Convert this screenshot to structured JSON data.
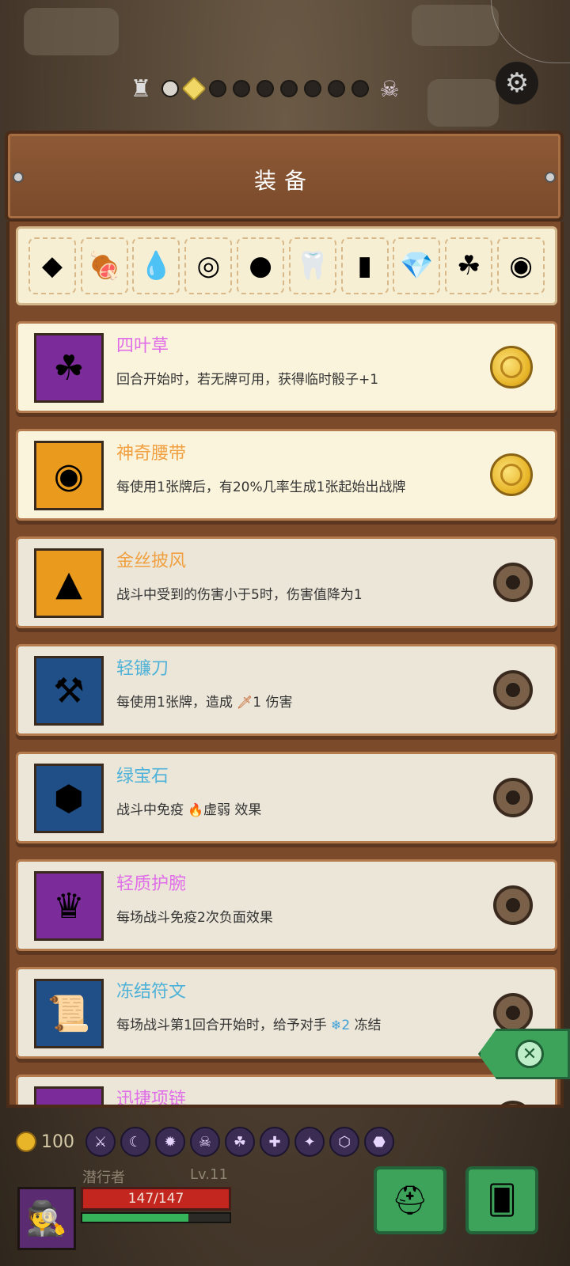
{
  "header": {
    "title": "装备"
  },
  "top_bar": {
    "castle_icon": "castle-icon",
    "boss_icon": "boss-skull-icon",
    "progress": {
      "total_nodes": 9,
      "completed": 1,
      "current_index": 1
    }
  },
  "equip_strip": {
    "slots": [
      {
        "icon": "ruby-ornament-icon",
        "glyph": "◆"
      },
      {
        "icon": "ham-icon",
        "glyph": "🍖"
      },
      {
        "icon": "water-drop-icon",
        "glyph": "💧"
      },
      {
        "icon": "spiked-bracelet-icon",
        "glyph": "◎"
      },
      {
        "icon": "button-icon",
        "glyph": "●"
      },
      {
        "icon": "fangs-icon",
        "glyph": "🦷"
      },
      {
        "icon": "moss-brick-icon",
        "glyph": "▮"
      },
      {
        "icon": "blue-gems-icon",
        "glyph": "💎"
      },
      {
        "icon": "four-leaf-clover-icon",
        "glyph": "☘"
      },
      {
        "icon": "magic-belt-icon",
        "glyph": "◉"
      }
    ]
  },
  "items": [
    {
      "name": "四叶草",
      "desc": "回合开始时，若无牌可用，获得临时骰子+1",
      "rarity": "purple",
      "icon": "four-leaf-clover-icon",
      "glyph": "☘",
      "coin": "gold"
    },
    {
      "name": "神奇腰带",
      "desc": "每使用1张牌后，有20%几率生成1张起始出战牌",
      "rarity": "orange",
      "icon": "magic-belt-icon",
      "glyph": "◉",
      "coin": "gold"
    },
    {
      "name": "金丝披风",
      "desc": "战斗中受到的伤害小于5时，伤害值降为1",
      "rarity": "orange",
      "icon": "golden-cloak-icon",
      "glyph": "▲",
      "coin": "dark"
    },
    {
      "name": "轻镰刀",
      "desc_pre": "每使用1张牌，造成",
      "desc_value": "1",
      "desc_post": "伤害",
      "rarity": "blue",
      "icon": "sickle-icon",
      "glyph": "⚒",
      "coin": "dark"
    },
    {
      "name": "绿宝石",
      "desc_pre": "战斗中免疫",
      "desc_value": "虚弱",
      "desc_post": "效果",
      "rarity": "blue",
      "icon": "emerald-icon",
      "glyph": "⬢",
      "coin": "dark"
    },
    {
      "name": "轻质护腕",
      "desc": "每场战斗免疫2次负面效果",
      "rarity": "purple",
      "icon": "light-bracer-icon",
      "glyph": "♛",
      "coin": "dark"
    },
    {
      "name": "冻结符文",
      "desc_pre": "每场战斗第1回合开始时，给予对手",
      "desc_value": "2",
      "desc_post": "冻结",
      "rarity": "blue",
      "icon": "frost-rune-scroll-icon",
      "glyph": "📜",
      "coin": "dark"
    },
    {
      "name": "迅捷项链",
      "rarity": "purple",
      "icon": "swift-necklace-icon",
      "glyph": "◠",
      "coin": "dark"
    }
  ],
  "hud": {
    "gold": "100",
    "hero_name": "潜行者",
    "level": "Lv.11",
    "hp": "147/147",
    "xp_fraction": 0.72,
    "statuses": [
      "⚔",
      "☾",
      "✹",
      "☠",
      "☘",
      "✚",
      "✦",
      "⬡",
      "⬣"
    ]
  },
  "colors": {
    "purple": "#7b2b9a",
    "orange": "#ea9a1c",
    "blue": "#1f4f86",
    "panel_wood": "#7a4a2b",
    "green_button": "#3ea35a"
  }
}
